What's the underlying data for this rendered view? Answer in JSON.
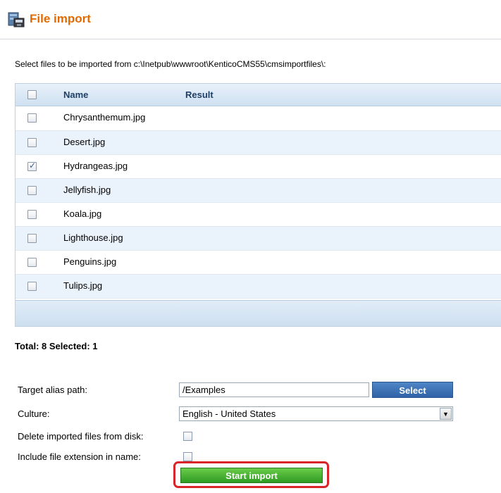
{
  "header": {
    "title": "File import"
  },
  "intro": "Select files to be imported from c:\\Inetpub\\wwwroot\\KenticoCMS55\\cmsimportfiles\\:",
  "grid": {
    "columns": [
      "Name",
      "Result"
    ],
    "rows": [
      {
        "name": "Chrysanthemum.jpg",
        "checked": false
      },
      {
        "name": "Desert.jpg",
        "checked": false
      },
      {
        "name": "Hydrangeas.jpg",
        "checked": true
      },
      {
        "name": "Jellyfish.jpg",
        "checked": false
      },
      {
        "name": "Koala.jpg",
        "checked": false
      },
      {
        "name": "Lighthouse.jpg",
        "checked": false
      },
      {
        "name": "Penguins.jpg",
        "checked": false
      },
      {
        "name": "Tulips.jpg",
        "checked": false
      }
    ]
  },
  "summary": "Total: 8   Selected: 1",
  "form": {
    "alias_label": "Target alias path:",
    "alias_value": "/Examples",
    "select_button": "Select",
    "culture_label": "Culture:",
    "culture_value": "English - United States",
    "delete_label": "Delete imported files from disk:",
    "extension_label": "Include file extension in name:",
    "start_button": "Start import"
  },
  "colors": {
    "accent": "#e26a00",
    "primary": "#2f62a6",
    "start": "#2f9b22",
    "highlight": "#d9242a"
  }
}
